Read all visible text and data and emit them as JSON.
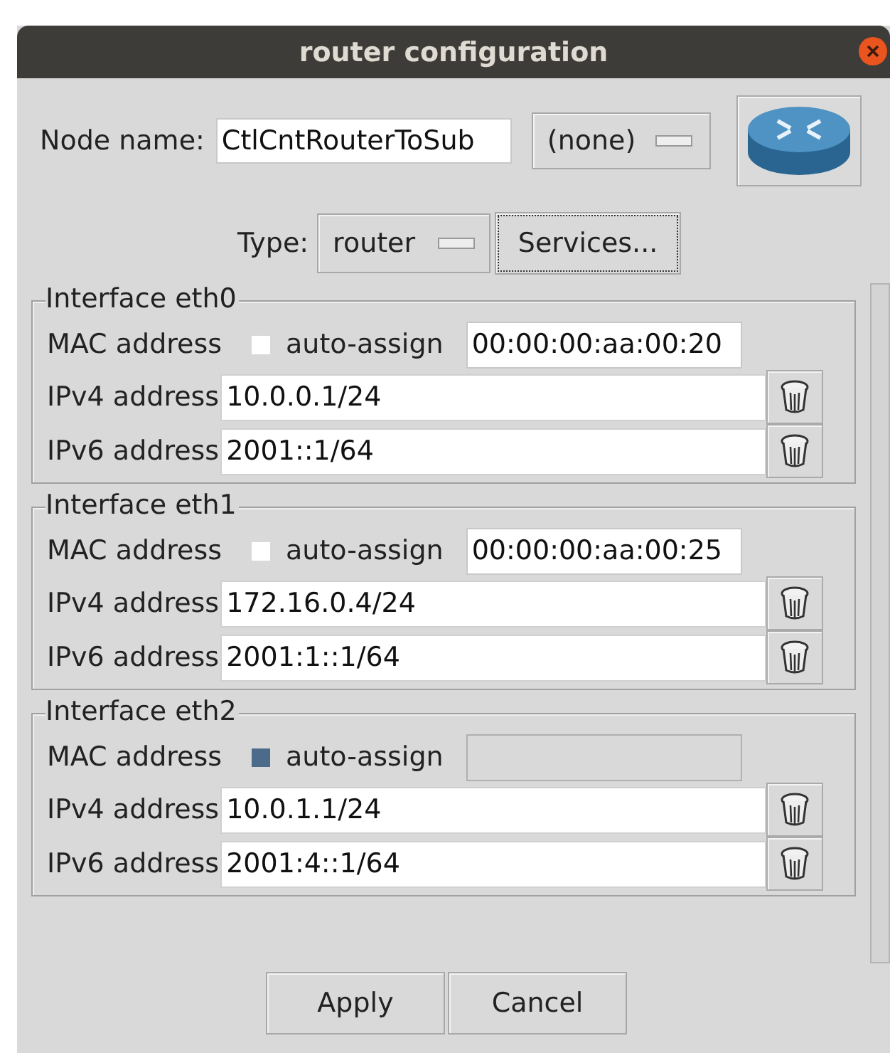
{
  "window": {
    "title": "router configuration"
  },
  "node_name": {
    "label": "Node name:",
    "value": "CtlCntRouterToSub"
  },
  "profile_menu": {
    "value": "(none)"
  },
  "type": {
    "label": "Type:",
    "value": "router"
  },
  "services_button": {
    "label": "Services..."
  },
  "interfaces": [
    {
      "title": "Interface eth0",
      "mac_label": "MAC address",
      "auto_assign_label": "auto-assign",
      "auto_assign": false,
      "mac": "00:00:00:aa:00:20",
      "ipv4_label": "IPv4 address",
      "ipv4": "10.0.0.1/24",
      "ipv6_label": "IPv6 address",
      "ipv6": "2001::1/64"
    },
    {
      "title": "Interface eth1",
      "mac_label": "MAC address",
      "auto_assign_label": "auto-assign",
      "auto_assign": false,
      "mac": "00:00:00:aa:00:25",
      "ipv4_label": "IPv4 address",
      "ipv4": "172.16.0.4/24",
      "ipv6_label": "IPv6 address",
      "ipv6": "2001:1::1/64"
    },
    {
      "title": "Interface eth2",
      "mac_label": "MAC address",
      "auto_assign_label": "auto-assign",
      "auto_assign": true,
      "ipv4_label": "IPv4 address",
      "ipv4": "10.0.1.1/24",
      "ipv6_label": "IPv6 address",
      "ipv6": "2001:4::1/64"
    }
  ],
  "buttons": [
    {
      "label": "Apply"
    },
    {
      "label": "Cancel"
    }
  ]
}
